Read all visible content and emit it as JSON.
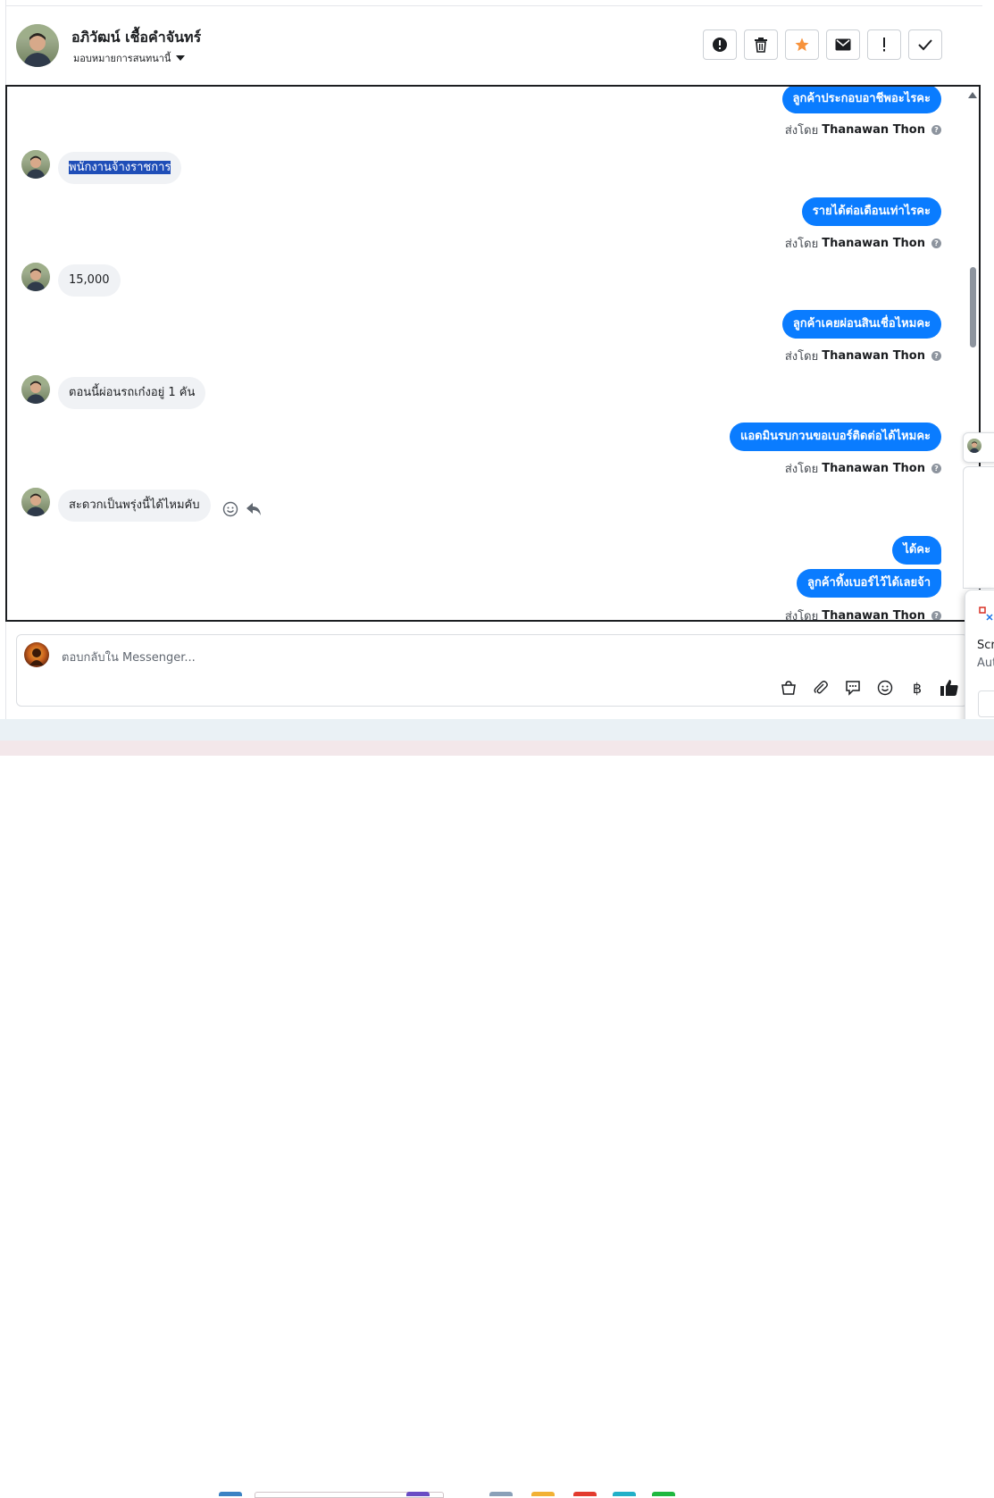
{
  "header": {
    "customer_name": "อภิวัฒน์ เชื้อคำจันทร์",
    "assign_label": "มอบหมายการสนทนานี้",
    "tools": [
      "alert-icon",
      "trash-icon",
      "star-icon",
      "envelope-icon",
      "exclamation-icon",
      "check-icon"
    ],
    "colors": {
      "star": "#f7923b"
    }
  },
  "conversation": {
    "sent_by_prefix": "ส่งโดย",
    "agent_name": "Thanawan Thon",
    "help_mark": "?",
    "colors": {
      "outgoing": "#0a7cff",
      "incoming": "#f0f2f5",
      "selection": "#1f4eb8"
    },
    "messages": [
      {
        "side": "out",
        "text": "ลูกค้าประกอบอาชีพอะไรคะ"
      },
      {
        "side": "in",
        "text": "พนักงานจ้างราชการ"
      },
      {
        "side": "out",
        "text": "รายได้ต่อเดือนเท่าไรคะ"
      },
      {
        "side": "in",
        "text": "15,000"
      },
      {
        "side": "out",
        "text": "ลูกค้าเคยผ่อนสินเชื่อไหมคะ"
      },
      {
        "side": "in",
        "text": "ตอนนี้ผ่อนรถเก๋งอยู่ 1 คัน"
      },
      {
        "side": "out",
        "text": "แอดมินรบกวนขอเบอร์ติดต่อได้ไหมคะ"
      },
      {
        "side": "in",
        "text": "สะดวกเป็นพรุ่งนี้ได้ไหมคับ"
      },
      {
        "side": "out",
        "text": "ได้คะ"
      },
      {
        "side": "out",
        "text": "ลูกค้าทิ้งเบอร์ไว้ได้เลยจ้า"
      }
    ]
  },
  "composer": {
    "placeholder": "ตอบกลับใน Messenger...",
    "tools": [
      "bag-icon",
      "paperclip-icon",
      "chat-bubble-icon",
      "emoji-icon",
      "baht-icon",
      "thumbs-up-icon"
    ],
    "baht_symbol": "฿"
  },
  "toast": {
    "line1": "Scr",
    "line2": "Aut"
  }
}
